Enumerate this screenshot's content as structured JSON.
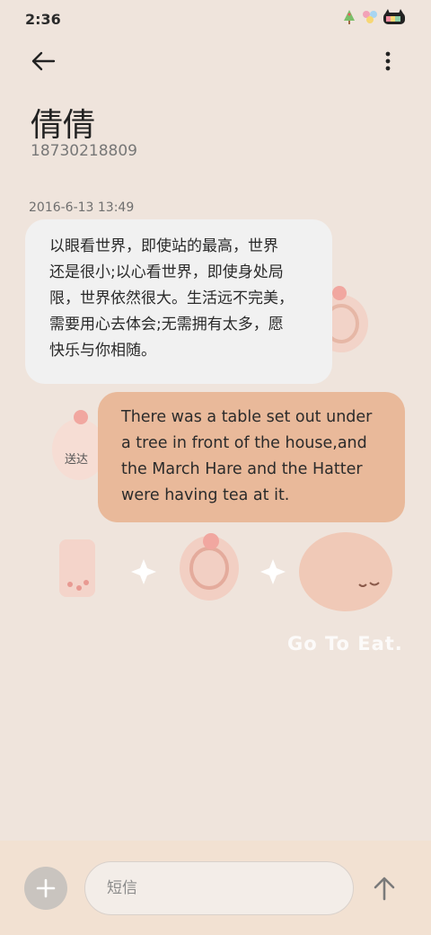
{
  "status_bar": {
    "time": "2:36",
    "icons": [
      "tree-icon",
      "flower-icon",
      "cat-battery-icon"
    ]
  },
  "header": {
    "back_icon": "arrow-left-icon",
    "more_icon": "vertical-dots-icon"
  },
  "contact": {
    "name": "倩倩",
    "phone": "18730218809"
  },
  "conversation": {
    "timestamp": "2016-6-13 13:49",
    "incoming": {
      "lines": [
        "以眼看世界，即使站的最高，世界",
        "还是很小;以心看世界，即使身处局",
        "限，世界依然很大。生活远不完美，",
        "需要用心去体会;无需拥有太多，愿",
        "快乐与你相随。"
      ]
    },
    "outgoing": {
      "lines": [
        "There was a table set out under",
        "a tree in front of the house,and",
        "the March Hare and the Hatter",
        "were having tea at it."
      ],
      "status": "送达"
    }
  },
  "background": {
    "watermark": "Go To Eat."
  },
  "composer": {
    "add_icon": "plus-icon",
    "placeholder": "短信",
    "send_icon": "arrow-up-icon"
  }
}
